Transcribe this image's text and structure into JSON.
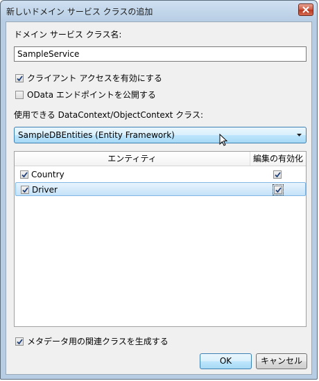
{
  "window": {
    "title": "新しいドメイン サービス クラスの追加"
  },
  "form": {
    "class_name_label": "ドメイン サービス クラス名:",
    "class_name_value": "SampleService",
    "client_access_label": "クライアント アクセスを有効にする",
    "odata_label": "OData エンドポイントを公開する",
    "context_label": "使用できる DataContext/ObjectContext クラス:",
    "context_selected": "SampleDBEntities (Entity Framework)"
  },
  "entities": {
    "headers": {
      "entity": "エンティティ",
      "edit": "編集の有効化"
    },
    "rows": [
      {
        "name": "Country",
        "include": true,
        "edit": true
      },
      {
        "name": "Driver",
        "include": true,
        "edit": true
      }
    ]
  },
  "metadata_label": "メタデータ用の関連クラスを生成する",
  "buttons": {
    "ok": "OK",
    "cancel": "キャンセル"
  },
  "colors": {
    "accent": "#3c7fb1",
    "selection": "#c4e2f8"
  }
}
